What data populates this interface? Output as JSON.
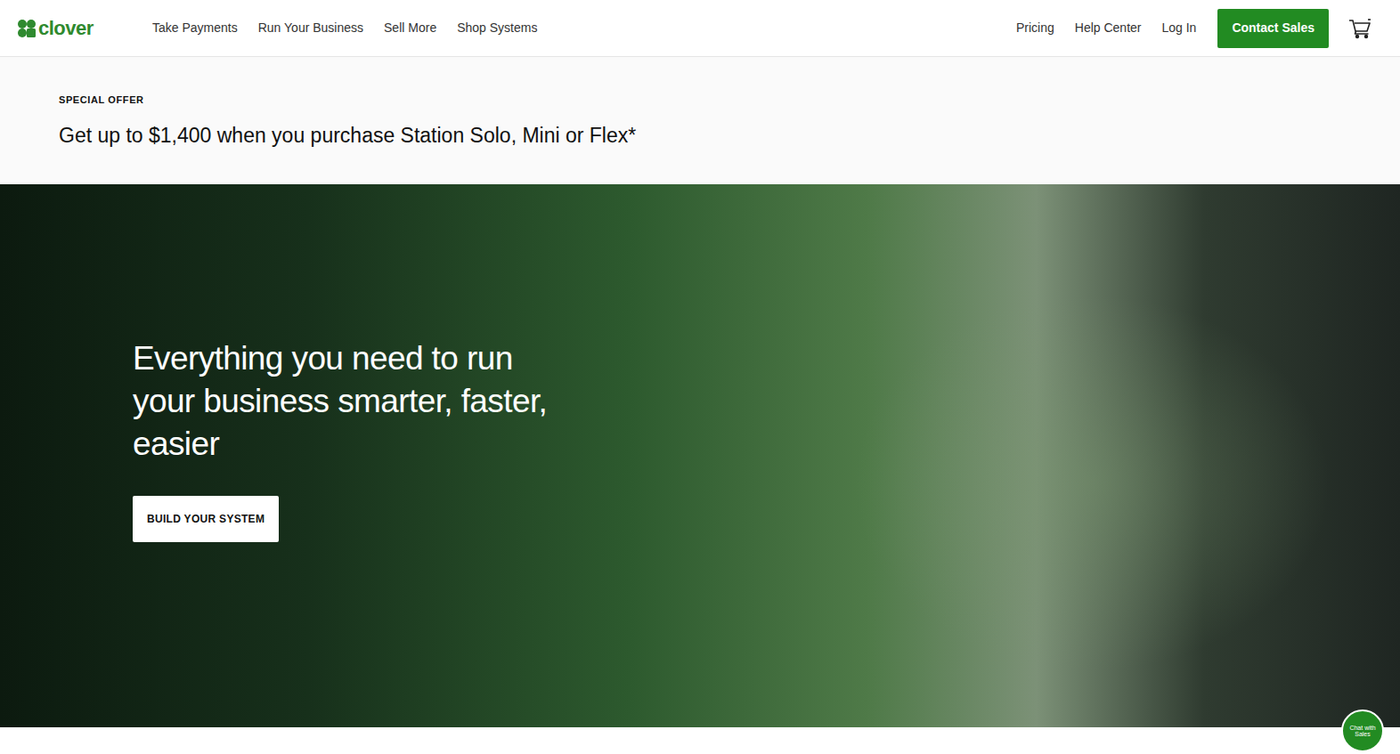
{
  "header": {
    "logo": "clover",
    "nav": [
      "Take Payments",
      "Run Your Business",
      "Sell More",
      "Shop Systems"
    ],
    "utility": [
      "Pricing",
      "Help Center",
      "Log In"
    ],
    "cta": "Contact Sales"
  },
  "offer": {
    "label": "SPECIAL OFFER",
    "headline": "Get up to $1,400 when you purchase Station Solo, Mini or Flex*"
  },
  "hero": {
    "headline_lines": [
      "Everything you need to run",
      "your business smarter, faster,",
      "easier"
    ],
    "button": "BUILD YOUR SYSTEM"
  },
  "chat": {
    "label": "Chat with Sales"
  }
}
